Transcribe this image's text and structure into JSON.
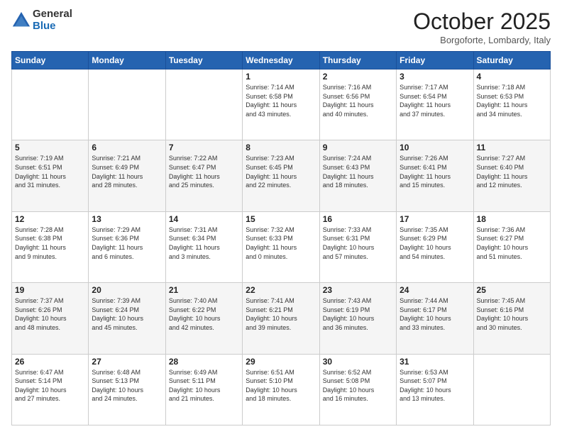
{
  "header": {
    "logo_general": "General",
    "logo_blue": "Blue",
    "title": "October 2025",
    "subtitle": "Borgoforte, Lombardy, Italy"
  },
  "days_of_week": [
    "Sunday",
    "Monday",
    "Tuesday",
    "Wednesday",
    "Thursday",
    "Friday",
    "Saturday"
  ],
  "weeks": [
    [
      {
        "day": "",
        "info": ""
      },
      {
        "day": "",
        "info": ""
      },
      {
        "day": "",
        "info": ""
      },
      {
        "day": "1",
        "info": "Sunrise: 7:14 AM\nSunset: 6:58 PM\nDaylight: 11 hours\nand 43 minutes."
      },
      {
        "day": "2",
        "info": "Sunrise: 7:16 AM\nSunset: 6:56 PM\nDaylight: 11 hours\nand 40 minutes."
      },
      {
        "day": "3",
        "info": "Sunrise: 7:17 AM\nSunset: 6:54 PM\nDaylight: 11 hours\nand 37 minutes."
      },
      {
        "day": "4",
        "info": "Sunrise: 7:18 AM\nSunset: 6:53 PM\nDaylight: 11 hours\nand 34 minutes."
      }
    ],
    [
      {
        "day": "5",
        "info": "Sunrise: 7:19 AM\nSunset: 6:51 PM\nDaylight: 11 hours\nand 31 minutes."
      },
      {
        "day": "6",
        "info": "Sunrise: 7:21 AM\nSunset: 6:49 PM\nDaylight: 11 hours\nand 28 minutes."
      },
      {
        "day": "7",
        "info": "Sunrise: 7:22 AM\nSunset: 6:47 PM\nDaylight: 11 hours\nand 25 minutes."
      },
      {
        "day": "8",
        "info": "Sunrise: 7:23 AM\nSunset: 6:45 PM\nDaylight: 11 hours\nand 22 minutes."
      },
      {
        "day": "9",
        "info": "Sunrise: 7:24 AM\nSunset: 6:43 PM\nDaylight: 11 hours\nand 18 minutes."
      },
      {
        "day": "10",
        "info": "Sunrise: 7:26 AM\nSunset: 6:41 PM\nDaylight: 11 hours\nand 15 minutes."
      },
      {
        "day": "11",
        "info": "Sunrise: 7:27 AM\nSunset: 6:40 PM\nDaylight: 11 hours\nand 12 minutes."
      }
    ],
    [
      {
        "day": "12",
        "info": "Sunrise: 7:28 AM\nSunset: 6:38 PM\nDaylight: 11 hours\nand 9 minutes."
      },
      {
        "day": "13",
        "info": "Sunrise: 7:29 AM\nSunset: 6:36 PM\nDaylight: 11 hours\nand 6 minutes."
      },
      {
        "day": "14",
        "info": "Sunrise: 7:31 AM\nSunset: 6:34 PM\nDaylight: 11 hours\nand 3 minutes."
      },
      {
        "day": "15",
        "info": "Sunrise: 7:32 AM\nSunset: 6:33 PM\nDaylight: 11 hours\nand 0 minutes."
      },
      {
        "day": "16",
        "info": "Sunrise: 7:33 AM\nSunset: 6:31 PM\nDaylight: 10 hours\nand 57 minutes."
      },
      {
        "day": "17",
        "info": "Sunrise: 7:35 AM\nSunset: 6:29 PM\nDaylight: 10 hours\nand 54 minutes."
      },
      {
        "day": "18",
        "info": "Sunrise: 7:36 AM\nSunset: 6:27 PM\nDaylight: 10 hours\nand 51 minutes."
      }
    ],
    [
      {
        "day": "19",
        "info": "Sunrise: 7:37 AM\nSunset: 6:26 PM\nDaylight: 10 hours\nand 48 minutes."
      },
      {
        "day": "20",
        "info": "Sunrise: 7:39 AM\nSunset: 6:24 PM\nDaylight: 10 hours\nand 45 minutes."
      },
      {
        "day": "21",
        "info": "Sunrise: 7:40 AM\nSunset: 6:22 PM\nDaylight: 10 hours\nand 42 minutes."
      },
      {
        "day": "22",
        "info": "Sunrise: 7:41 AM\nSunset: 6:21 PM\nDaylight: 10 hours\nand 39 minutes."
      },
      {
        "day": "23",
        "info": "Sunrise: 7:43 AM\nSunset: 6:19 PM\nDaylight: 10 hours\nand 36 minutes."
      },
      {
        "day": "24",
        "info": "Sunrise: 7:44 AM\nSunset: 6:17 PM\nDaylight: 10 hours\nand 33 minutes."
      },
      {
        "day": "25",
        "info": "Sunrise: 7:45 AM\nSunset: 6:16 PM\nDaylight: 10 hours\nand 30 minutes."
      }
    ],
    [
      {
        "day": "26",
        "info": "Sunrise: 6:47 AM\nSunset: 5:14 PM\nDaylight: 10 hours\nand 27 minutes."
      },
      {
        "day": "27",
        "info": "Sunrise: 6:48 AM\nSunset: 5:13 PM\nDaylight: 10 hours\nand 24 minutes."
      },
      {
        "day": "28",
        "info": "Sunrise: 6:49 AM\nSunset: 5:11 PM\nDaylight: 10 hours\nand 21 minutes."
      },
      {
        "day": "29",
        "info": "Sunrise: 6:51 AM\nSunset: 5:10 PM\nDaylight: 10 hours\nand 18 minutes."
      },
      {
        "day": "30",
        "info": "Sunrise: 6:52 AM\nSunset: 5:08 PM\nDaylight: 10 hours\nand 16 minutes."
      },
      {
        "day": "31",
        "info": "Sunrise: 6:53 AM\nSunset: 5:07 PM\nDaylight: 10 hours\nand 13 minutes."
      },
      {
        "day": "",
        "info": ""
      }
    ]
  ]
}
